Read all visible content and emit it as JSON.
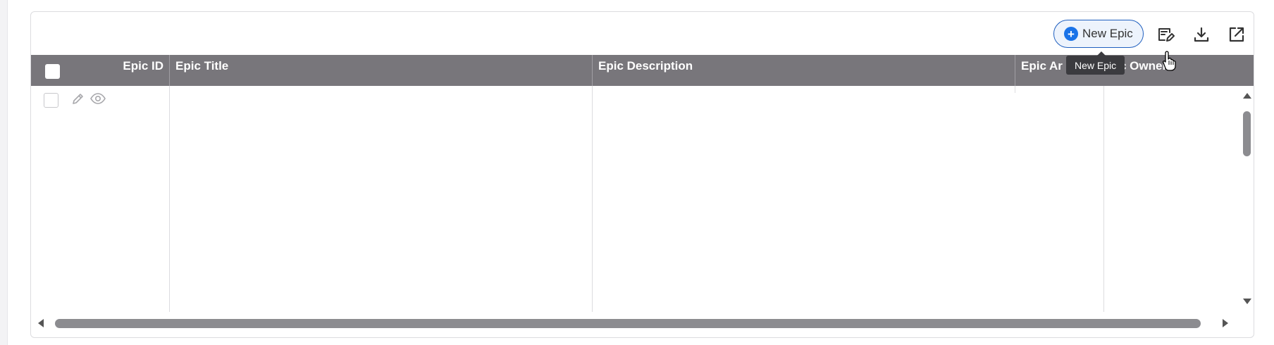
{
  "toolbar": {
    "new_epic_label": "New Epic",
    "tooltip_text": "New Epic",
    "icons": [
      "plus-circle-icon",
      "edit-note-icon",
      "download-icon",
      "open-external-icon"
    ]
  },
  "table": {
    "columns": [
      "Epic ID",
      "Epic Title",
      "Epic Description",
      "Epic Ar",
      "c Owner"
    ],
    "rows": []
  },
  "colors": {
    "header_bg": "#78767b",
    "accent": "#1a73e8",
    "tooltip_bg": "#3b3b3f"
  }
}
